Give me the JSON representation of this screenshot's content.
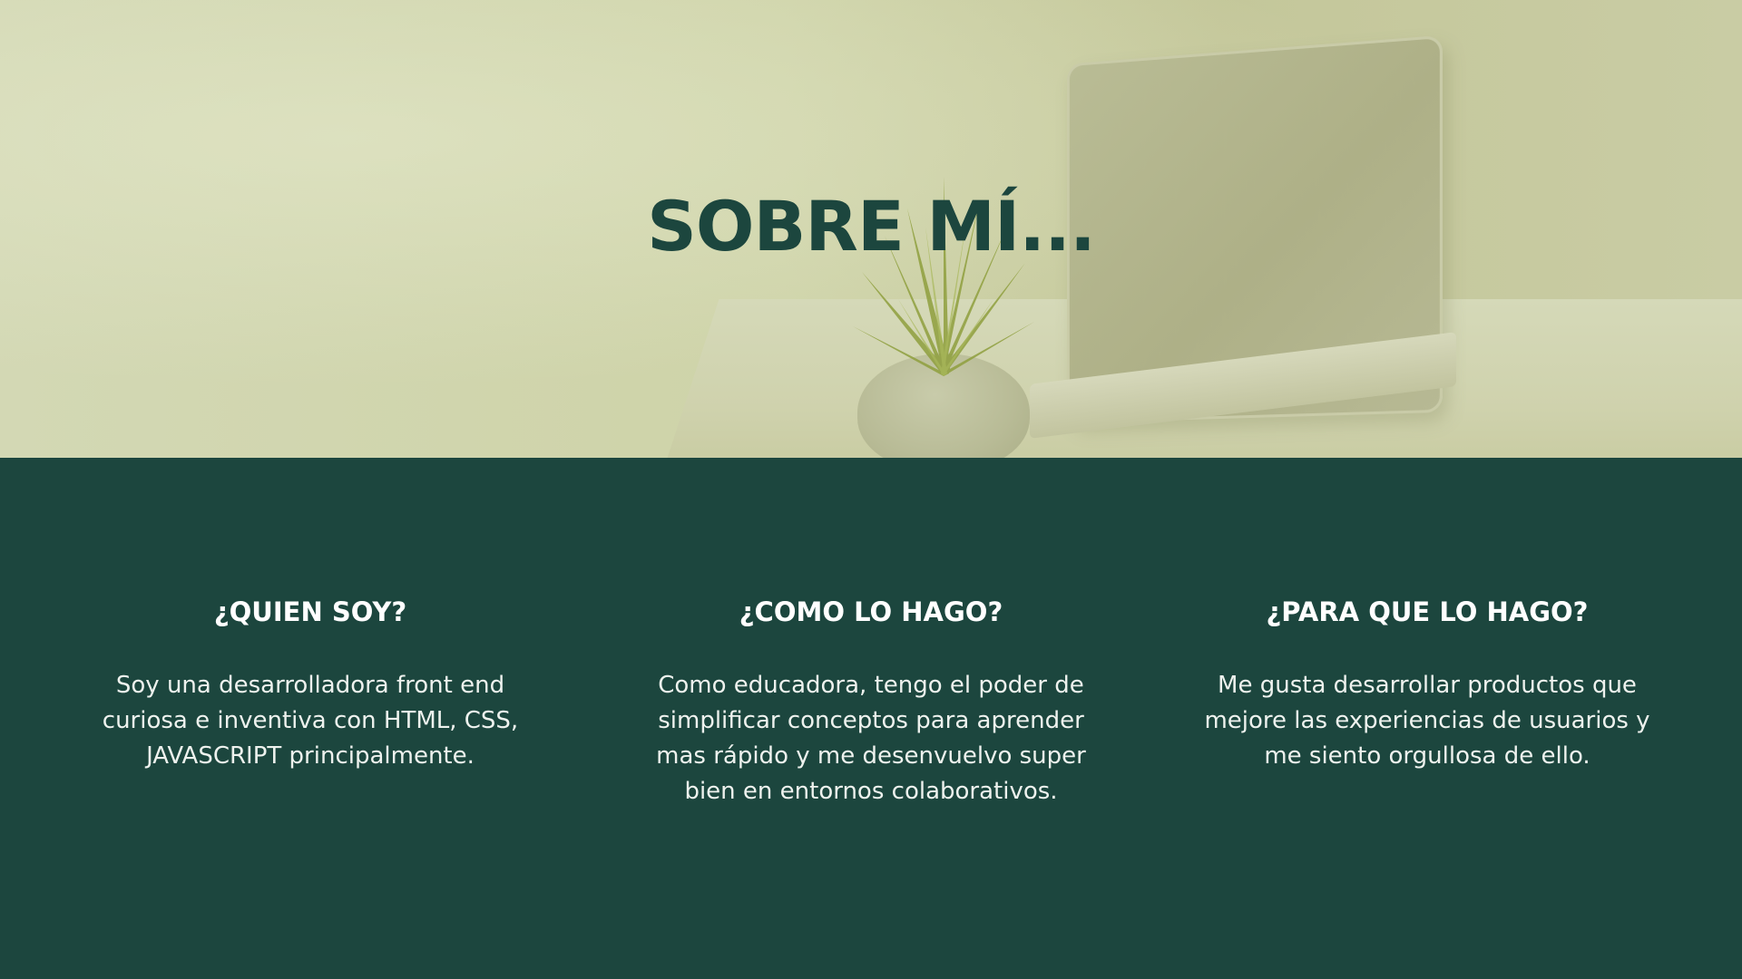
{
  "hero": {
    "title": "SOBRE MÍ..."
  },
  "columns": [
    {
      "heading": "¿QUIEN SOY?",
      "text": "Soy una desarrolladora front end curiosa e inventiva con HTML, CSS, JAVASCRIPT principalmente."
    },
    {
      "heading": "¿COMO LO HAGO?",
      "text": "Como educadora, tengo el poder de simplificar conceptos para aprender mas rápido y me desenvuelvo super bien en entornos colaborativos."
    },
    {
      "heading": "¿PARA QUE LO HAGO?",
      "text": "Me gusta desarrollar productos que mejore las experiencias de usuarios y me siento orgullosa de ello."
    }
  ],
  "colors": {
    "dark_green": "#1c463e",
    "hero_tint": "#ced3a8",
    "text_light": "#ffffff"
  }
}
